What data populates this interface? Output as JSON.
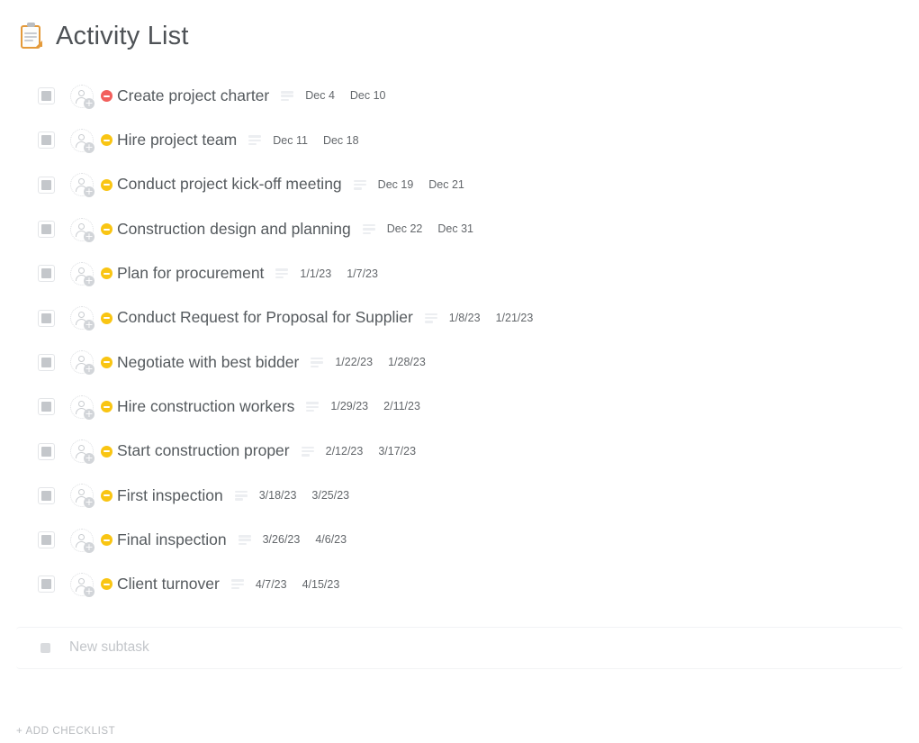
{
  "header": {
    "icon": "clipboard-icon",
    "title": "Activity List"
  },
  "colors": {
    "priority_red": "#f25f5c",
    "priority_yellow": "#f9c513",
    "task_text": "#555a5e",
    "date_text": "#63676b",
    "placeholder": "#c3c6ca",
    "footer_link": "#b7babe",
    "clipboard_orange": "#e49a3a"
  },
  "tasks": [
    {
      "checked": false,
      "assignee": "add-assignee",
      "priority": "red",
      "name": "Create project charter",
      "has_description": true,
      "start": "Dec 4",
      "end": "Dec 10"
    },
    {
      "checked": false,
      "assignee": "add-assignee",
      "priority": "yellow",
      "name": "Hire project team",
      "has_description": true,
      "start": "Dec 11",
      "end": "Dec 18"
    },
    {
      "checked": false,
      "assignee": "add-assignee",
      "priority": "yellow",
      "name": "Conduct project kick-off meeting",
      "has_description": true,
      "start": "Dec 19",
      "end": "Dec 21"
    },
    {
      "checked": false,
      "assignee": "add-assignee",
      "priority": "yellow",
      "name": "Construction design and planning",
      "has_description": true,
      "start": "Dec 22",
      "end": "Dec 31"
    },
    {
      "checked": false,
      "assignee": "add-assignee",
      "priority": "yellow",
      "name": "Plan for procurement",
      "has_description": true,
      "start": "1/1/23",
      "end": "1/7/23"
    },
    {
      "checked": false,
      "assignee": "add-assignee",
      "priority": "yellow",
      "name": "Conduct Request for Proposal for Supplier",
      "has_description": true,
      "start": "1/8/23",
      "end": "1/21/23"
    },
    {
      "checked": false,
      "assignee": "add-assignee",
      "priority": "yellow",
      "name": "Negotiate with best bidder",
      "has_description": true,
      "start": "1/22/23",
      "end": "1/28/23"
    },
    {
      "checked": false,
      "assignee": "add-assignee",
      "priority": "yellow",
      "name": "Hire construction workers",
      "has_description": true,
      "start": "1/29/23",
      "end": "2/11/23"
    },
    {
      "checked": false,
      "assignee": "add-assignee",
      "priority": "yellow",
      "name": "Start construction proper",
      "has_description": true,
      "start": "2/12/23",
      "end": "3/17/23"
    },
    {
      "checked": false,
      "assignee": "add-assignee",
      "priority": "yellow",
      "name": "First inspection",
      "has_description": true,
      "start": "3/18/23",
      "end": "3/25/23"
    },
    {
      "checked": false,
      "assignee": "add-assignee",
      "priority": "yellow",
      "name": "Final inspection",
      "has_description": true,
      "start": "3/26/23",
      "end": "4/6/23"
    },
    {
      "checked": false,
      "assignee": "add-assignee",
      "priority": "yellow",
      "name": "Client turnover",
      "has_description": true,
      "start": "4/7/23",
      "end": "4/15/23"
    }
  ],
  "new_subtask": {
    "placeholder": "New subtask"
  },
  "footer": {
    "add_checklist_label": "+ Add Checklist"
  }
}
